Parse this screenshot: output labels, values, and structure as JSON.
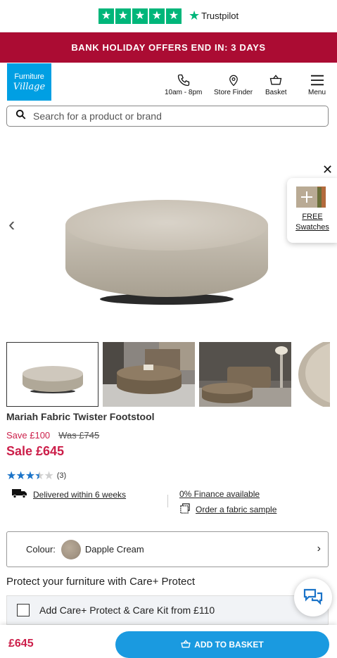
{
  "trustpilot": {
    "brand": "Trustpilot",
    "star_count": 5,
    "color": "#00b67a"
  },
  "promo": {
    "text": "BANK HOLIDAY OFFERS END IN: 3 DAYS",
    "bg_color": "#ab0c33"
  },
  "header": {
    "logo_line1": "Furniture",
    "logo_line2": "Village",
    "logo_color": "#009fe3",
    "nav": [
      {
        "label": "10am - 8pm",
        "icon": "phone-icon"
      },
      {
        "label": "Store Finder",
        "icon": "location-pin-icon"
      },
      {
        "label": "Basket",
        "icon": "basket-icon"
      },
      {
        "label": "Menu",
        "icon": "hamburger-menu-icon"
      }
    ]
  },
  "search": {
    "placeholder": "Search for a product or brand"
  },
  "gallery": {
    "prev_glyph": "‹",
    "close_glyph": "✕",
    "swatch_label_1": "FREE",
    "swatch_label_2": "Swatches",
    "thumbnail_count": 4
  },
  "product": {
    "title": "Mariah Fabric Twister Footstool",
    "save": "Save £100",
    "was": "Was £745",
    "sale": "Sale £645",
    "rating_stars": 3.5,
    "rating_count": "(3)",
    "delivery": "Delivered within 6 weeks",
    "finance": "0% Finance available",
    "fabric_sample": "Order a fabric sample"
  },
  "colour": {
    "label": "Colour:",
    "value": "Dapple Cream",
    "chevron": "›"
  },
  "protect": {
    "heading": "Protect your furniture with Care+ Protect",
    "option": "Add Care+ Protect & Care Kit from £110"
  },
  "bottom": {
    "price": "£645",
    "button": "ADD TO BASKET",
    "button_color": "#1a9ae0"
  },
  "accent_red": "#cc1f4a"
}
